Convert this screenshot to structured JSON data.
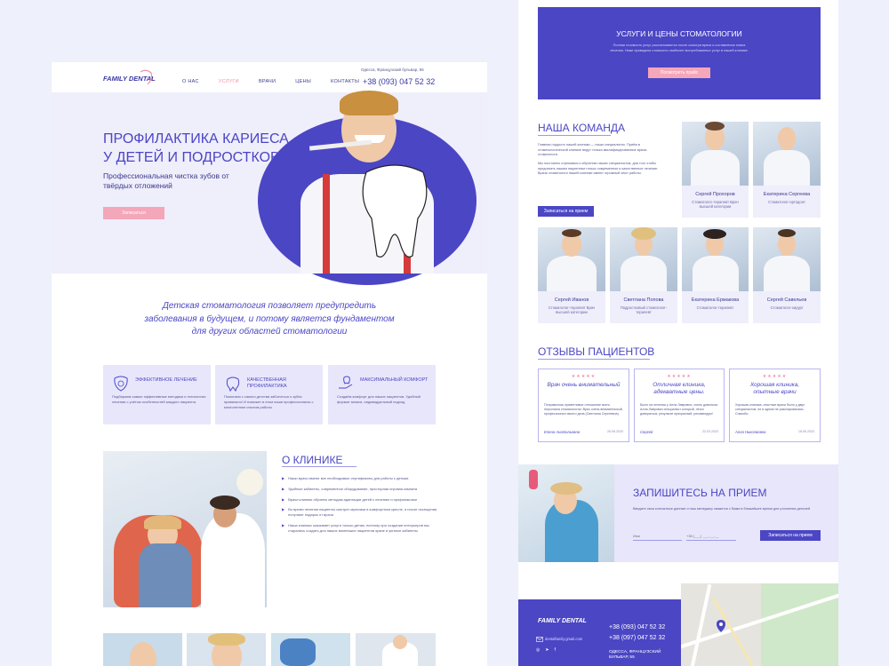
{
  "header": {
    "logo": "FAMILY DENTAL",
    "nav": [
      "О НАС",
      "УСЛУГИ",
      "ВРАЧИ",
      "ЦЕНЫ",
      "КОНТАКТЫ"
    ],
    "address": "Одесса, Французский бульвар, 55",
    "phone": "+38 (093) 047 52 32"
  },
  "hero": {
    "title": "ПРОФИЛАКТИКА КАРИЕСА У ДЕТЕЙ И ПОДРОСТКОВ",
    "subtitle": "Профессиональная чистка зубов от твёрдых отложений",
    "button": "Записаться"
  },
  "quote": "Детская стоматология позволяет предупредить заболевания в будущем, и потому является фундаментом для других областей стоматологии",
  "features": [
    {
      "title": "ЭФФЕКТИВНОЕ ЛЕЧЕНИЕ",
      "text": "Подбираем самые эффективные методики и технологии лечения с учётом особенностей каждого пациента",
      "icon": "tooth-shield-icon"
    },
    {
      "title": "КАЧЕСТВЕННАЯ ПРОФИЛАКТИКА",
      "text": "Помогаем с самого детства заботиться о зубах правильно! И поможет в этом наши профессионалы с многолетним опытом работы",
      "icon": "tooth-sparkle-icon"
    },
    {
      "title": "МАКСИМАЛЬНЫЙ КОМФОРТ",
      "text": "Создаём комфорт для наших пациентов. Удобный формат записи, индивидуальный подход",
      "icon": "hand-tooth-icon"
    }
  ],
  "about": {
    "title": "О КЛИНИКЕ",
    "items": [
      "Наши врачи имеют все необходимые сертификаты для работы с детьми",
      "Удобные кабинеты, современное оборудование, просторная игровая комната",
      "Врачи клиники обучены методам адаптации детей к лечению и профилактике",
      "Во время лечения пациенты смотрят мультики в комфортном кресле, а после посещения получают подарок от врача",
      "Наша клиника оказывает услуги только детям, поэтому при создании интерьеров мы старались создать для наших маленьких пациентов яркие и уютные кабинеты"
    ]
  },
  "services": {
    "title": "УСЛУГИ И ЦЕНЫ СТОМАТОЛОГИИ",
    "text": "Полная стоимость услуг рассчитывается после осмотра врача и составления плана лечения. Ниже приведена стоимость наиболее востребованных услуг в нашей клинике.",
    "button": "Посмотреть прайс"
  },
  "team": {
    "title": "НАША КОМАНДА",
    "text1": "Главная гордость нашей клиники — наши специалисты. Приём в стоматологической клинике ведут только квалифицированные врачи-стоматологи.",
    "text2": "Мы постоянно стремимся к обучению наших специалистов, для того чтобы предлагать нашим пациентам только современное и качественное лечение. Врачи стоматологи нашей клиники имеют огромный опыт работы.",
    "button": "Записаться на прием",
    "members": [
      {
        "name": "Сергей Прохоров",
        "role": "Стоматолог-терапевт Врач высшей категории"
      },
      {
        "name": "Екатерина Сергеева",
        "role": "Стоматолог-ортодонт"
      },
      {
        "name": "Сергей Иванов",
        "role": "Стоматолог-терапевт Врач высшей категории"
      },
      {
        "name": "Светлана Попова",
        "role": "Подростковый стоматолог-терапевт"
      },
      {
        "name": "Екатерина Ермакова",
        "role": "Стоматолог-терапевт"
      },
      {
        "name": "Сергей Савельев",
        "role": "Стоматолог-хирург"
      }
    ]
  },
  "reviews": {
    "title": "ОТЗЫВЫ ПАЦИЕНТОВ",
    "stars": "★★★★★",
    "items": [
      {
        "title": "Врач очень внимательный",
        "text": "Понравилось приветливое отношение всего персонала стоматологии. Врач очень внимательный, профессионал своего дела (Светлана Сергеевна).",
        "author": "Елена Анатольевна",
        "date": "26.08.2020"
      },
      {
        "title": "Отличная клиника, адекватные цены.",
        "text": "Было на лечении у Алла Лаврович, очень довольна. Алла Лаврович специалист который, легко довериться, результат прекрасный, рекомендую!",
        "author": "Сергей",
        "date": "22.03.2020"
      },
      {
        "title": "Хорошая клиника, опытные врачи",
        "text": "Хорошая клиника, опытные врачи было у двух специалистов, ни в одном не разочаровалась. Спасибо.",
        "author": "Алла Николаевна",
        "date": "18.06.2020"
      }
    ]
  },
  "signup": {
    "title": "ЗАПИШИТЕСЬ НА ПРИЕМ",
    "text": "Введите свои контактные данные и наш менеджер свяжется с Вами в ближайшее время для уточнения деталей",
    "name_placeholder": "Имя",
    "phone_placeholder": "+38 (___) ___-__-__",
    "button": "Записаться на прием"
  },
  "footer": {
    "logo": "FAMILY DENTAL",
    "email": "dentalfamily.gmail.com",
    "phone1": "+38 (093) 047 52 32",
    "phone2": "+38 (097) 047 52 32",
    "address": "ОДЕССА, ФРАНЦУЗСКИЙ БУЛЬВАР, 55"
  },
  "colors": {
    "accent": "#4b46c4",
    "pink": "#f4a7b9",
    "lavender": "#e8e6fb"
  }
}
